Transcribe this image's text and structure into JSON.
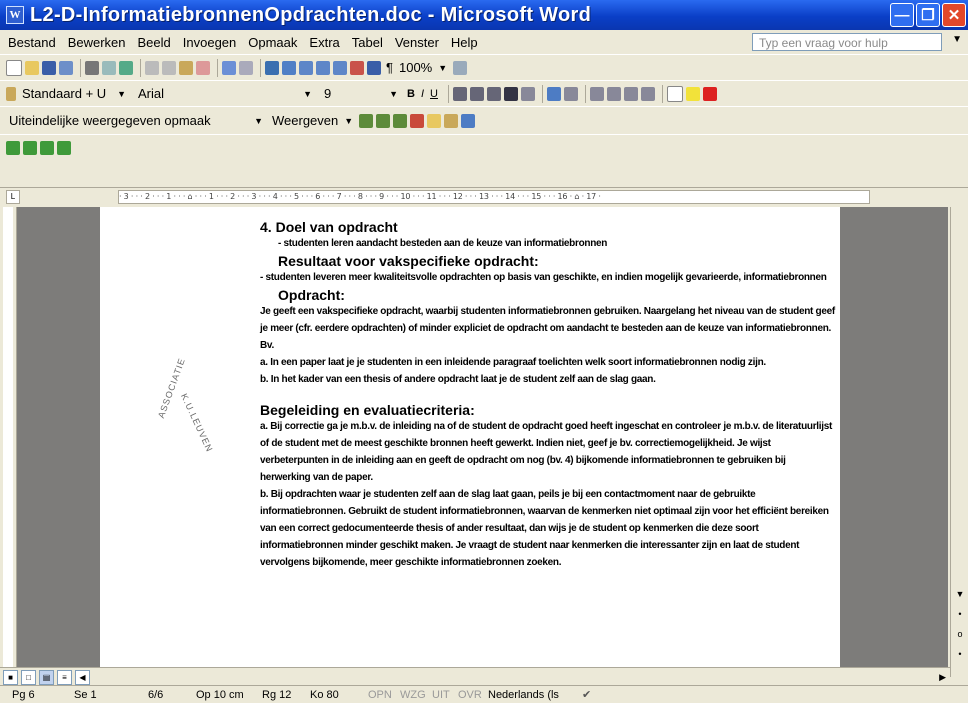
{
  "window": {
    "title": "L2-D-InformatiebronnenOpdrachten.doc - Microsoft Word",
    "icon": "word-icon",
    "controls": [
      "minimize-icon",
      "restore-icon",
      "close-icon"
    ]
  },
  "menubar": {
    "items": [
      "Bestand",
      "Bewerken",
      "Beeld",
      "Invoegen",
      "Opmaak",
      "Extra",
      "Tabel",
      "Venster",
      "Help"
    ],
    "help_placeholder": "Typ een vraag voor hulp"
  },
  "standard_toolbar": {
    "zoom": "100%"
  },
  "formatting_toolbar": {
    "style": "Standaard + U",
    "font": "Arial",
    "size": "9"
  },
  "review_toolbar": {
    "display": "Uiteindelijke weergegeven opmaak",
    "show": "Weergeven"
  },
  "document": {
    "heading_number": "4.",
    "heading1": "Doel van opdracht",
    "p1": "- studenten leren aandacht besteden aan de keuze van informatiebronnen",
    "heading2": "Resultaat voor vakspecifieke opdracht:",
    "p2": "- studenten leveren meer kwaliteitsvolle opdrachten op basis van geschikte, en indien mogelijk gevarieerde, informatiebronnen",
    "heading3": "Opdracht:",
    "p3": "Je geeft een vakspecifieke opdracht, waarbij studenten informatiebronnen gebruiken. Naargelang het niveau van de student geef je meer (cfr. eerdere opdrachten) of minder expliciet de opdracht om aandacht te besteden aan de keuze van informatiebronnen.",
    "p4": "Bv.",
    "p5": "a. In een paper laat je je studenten in een inleidende paragraaf toelichten welk soort informatiebronnen nodig zijn.",
    "p6": "b. In het kader van een thesis of andere opdracht laat je de student zelf aan de slag gaan.",
    "heading4": "Begeleiding en evaluatiecriteria:",
    "p7": "a. Bij correctie ga je m.b.v. de inleiding na of de student de opdracht goed heeft ingeschat en controleer je m.b.v. de literatuurlijst of de student met de meest geschikte bronnen heeft gewerkt. Indien niet, geef je bv. correctiemogelijkheid. Je wijst verbeterpunten in de inleiding aan en geeft de opdracht om nog (bv. 4) bijkomende informatiebronnen te gebruiken bij herwerking van de paper.",
    "p8": "b. Bij opdrachten waar je studenten zelf aan de slag laat gaan, peils je bij een contactmoment naar de gebruikte informatiebronnen. Gebruikt de student informatiebronnen, waarvan de kenmerken niet optimaal zijn voor het efficiënt bereiken van een correct gedocumenteerde thesis of ander resultaat, dan wijs je de student op kenmerken die deze soort informatiebronnen minder geschikt maken. Je vraagt de student naar kenmerken die interessanter zijn en laat de student vervolgens bijkomende, meer geschikte informatiebronnen zoeken.",
    "seal_left": "ASSOCIATIE",
    "seal_right": "K.U.LEUVEN"
  },
  "statusbar": {
    "page": "Pg 6",
    "section": "Se 1",
    "pages": "6/6",
    "position": "Op 10 cm",
    "line": "Rg 12",
    "column": "Ko 80",
    "rec": "OPN",
    "trk": "WZG",
    "ext": "UIT",
    "ovr": "OVR",
    "language": "Nederlands (ls"
  },
  "colors": {
    "titlebar": "#0a3fc7",
    "chrome": "#ece9d8",
    "gray_area": "#7d7c7a"
  }
}
